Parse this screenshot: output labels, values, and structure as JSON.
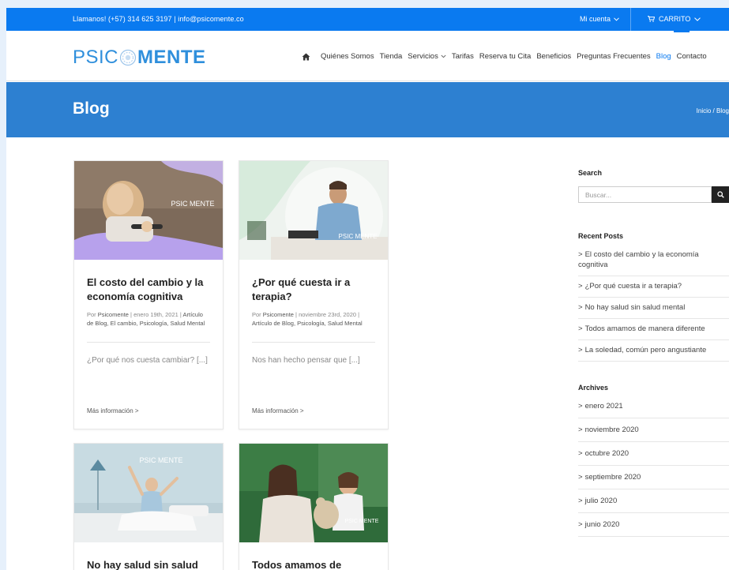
{
  "topbar": {
    "contact": "Llamanos! (+57) 314 625 3197 | info@psicomente.co",
    "account_label": "Mi cuenta",
    "cart_label": "CARRITO"
  },
  "logo": {
    "part1": "PSIC",
    "part2": "MENTE"
  },
  "nav": {
    "items": [
      {
        "label": "Quiénes Somos"
      },
      {
        "label": "Tienda"
      },
      {
        "label": "Servicios"
      },
      {
        "label": "Tarifas"
      },
      {
        "label": "Reserva tu Cita"
      },
      {
        "label": "Beneficios"
      },
      {
        "label": "Preguntas Frecuentes"
      },
      {
        "label": "Blog"
      },
      {
        "label": "Contacto"
      }
    ]
  },
  "title": {
    "heading": "Blog",
    "breadcrumb": "Inicio / Blog"
  },
  "posts": [
    {
      "title": "El costo del cambio y la economía cognitiva",
      "meta_prefix": "Por ",
      "author": "Psicomente",
      "meta_date": " | enero 19th, 2021 | ",
      "categories": "Artículo de Blog, El cambio, Psicología, Salud Mental",
      "excerpt": "¿Por qué nos cuesta cambiar? [...]",
      "more": "Más información >",
      "watermark": "PSIC MENTE"
    },
    {
      "title": "¿Por qué cuesta ir a terapia?",
      "meta_prefix": "Por ",
      "author": "Psicomente",
      "meta_date": " | noviembre 23rd, 2020 | ",
      "categories": "Artículo de Blog, Psicología, Salud Mental",
      "excerpt": "Nos han hecho pensar que [...]",
      "more": "Más información >",
      "watermark": "PSIC MENTE"
    },
    {
      "title": "No hay salud sin salud",
      "watermark": "PSIC MENTE"
    },
    {
      "title": "Todos amamos de",
      "watermark": "PSIC MENTE"
    }
  ],
  "sidebar": {
    "search_heading": "Search",
    "search_placeholder": "Buscar...",
    "recent_heading": "Recent Posts",
    "recent": [
      "El costo del cambio y la economía cognitiva",
      "¿Por qué cuesta ir a terapia?",
      "No hay salud sin salud mental",
      "Todos amamos de manera diferente",
      "La soledad, común pero angustiante"
    ],
    "archives_heading": "Archives",
    "archives": [
      "enero 2021",
      "noviembre 2020",
      "octubre 2020",
      "septiembre 2020",
      "julio 2020",
      "junio 2020"
    ]
  },
  "colors": {
    "topbar": "#0a7af0",
    "titlebar": "#2d80d1",
    "logo": "#2f8fdc",
    "active": "#0a7af0"
  },
  "icons": [
    "home-icon",
    "chevron-down-icon",
    "cart-icon",
    "search-icon",
    "logo-mark-icon"
  ]
}
